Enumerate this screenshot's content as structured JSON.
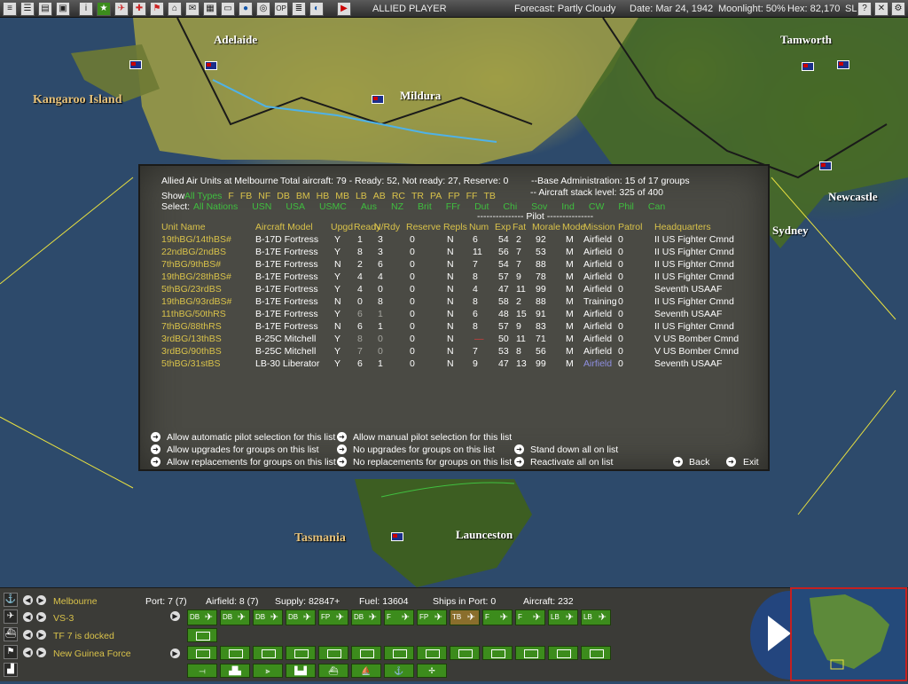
{
  "topbar": {
    "side": "ALLIED PLAYER",
    "forecast": "Forecast: Partly Cloudy",
    "date": "Date: Mar 24, 1942",
    "moonlight": "Moonlight: 50%",
    "hex": "Hex: 82,170",
    "sl": "SL:",
    "icons": [
      "menu-icon",
      "list-icon",
      "file-icon",
      "computer-icon",
      "info-icon",
      "star-icon",
      "plane-icon",
      "ship-icon",
      "flag-icon",
      "chart-icon",
      "map-icon",
      "base-icon",
      "globe-icon",
      "target-icon",
      "op-icon",
      "report-icon",
      "moon-icon",
      "play-icon"
    ]
  },
  "map_labels": {
    "adelaide": "Adelaide",
    "kangaroo": "Kangaroo Island",
    "mildura": "Mildura",
    "tamworth": "Tamworth",
    "newcastle": "Newcastle",
    "sydney": "Sydney",
    "tasmania": "Tasmania",
    "launceston": "Launceston"
  },
  "dialog": {
    "header": "Allied Air Units at Melbourne",
    "total": "Total aircraft: 79 - Ready: 52, Not ready: 27, Reserve: 0",
    "base_admin": "--Base Administration: 15 of 17 groups",
    "stack": "-- Aircraft stack level: 325 of 400",
    "show_label": "Show",
    "show_types": [
      "All Types",
      "F",
      "FB",
      "NF",
      "DB",
      "BM",
      "HB",
      "MB",
      "LB",
      "AB",
      "RC",
      "TR",
      "PA",
      "FP",
      "FF",
      "TB"
    ],
    "select_label": "Select:",
    "select_nations": [
      "All Nations",
      "USN",
      "USA",
      "USMC",
      "Aus",
      "NZ",
      "Brit",
      "FFr",
      "Dut",
      "Chi",
      "Sov",
      "Ind",
      "CW",
      "Phil",
      "Can"
    ],
    "pilot_group": "--------------- Pilot ---------------",
    "columns": [
      "Unit Name",
      "Aircraft Model",
      "Upgd",
      "Ready",
      "N/Rdy",
      "Reserve",
      "Repls",
      "Num",
      "Exp",
      "Fat",
      "Morale",
      "Mode",
      "Mission",
      "Patrol",
      "Headquarters"
    ],
    "rows": [
      [
        "19thBG/14thBS#",
        "B-17D Fortress",
        "Y",
        "1",
        "3",
        "0",
        "N",
        "6",
        "54",
        "2",
        "92",
        "M",
        "Airfield",
        "0",
        "II US Fighter Cmnd"
      ],
      [
        "22ndBG/2ndBS",
        "B-17E Fortress",
        "Y",
        "8",
        "3",
        "0",
        "N",
        "11",
        "56",
        "7",
        "53",
        "M",
        "Airfield",
        "0",
        "II US Fighter Cmnd"
      ],
      [
        "7thBG/9thBS#",
        "B-17E Fortress",
        "N",
        "2",
        "6",
        "0",
        "N",
        "7",
        "54",
        "7",
        "88",
        "M",
        "Airfield",
        "0",
        "II US Fighter Cmnd"
      ],
      [
        "19thBG/28thBS#",
        "B-17E Fortress",
        "Y",
        "4",
        "4",
        "0",
        "N",
        "8",
        "57",
        "9",
        "78",
        "M",
        "Airfield",
        "0",
        "II US Fighter Cmnd"
      ],
      [
        "5thBG/23rdBS",
        "B-17E Fortress",
        "Y",
        "4",
        "0",
        "0",
        "N",
        "4",
        "47",
        "11",
        "99",
        "M",
        "Airfield",
        "0",
        "Seventh USAAF"
      ],
      [
        "19thBG/93rdBS#",
        "B-17E Fortress",
        "N",
        "0",
        "8",
        "0",
        "N",
        "8",
        "58",
        "2",
        "88",
        "M",
        "Training",
        "0",
        "II US Fighter Cmnd"
      ],
      [
        "11thBG/50thRS",
        "B-17E Fortress",
        "Y",
        "6",
        "1",
        "0",
        "N",
        "6",
        "48",
        "15",
        "91",
        "M",
        "Airfield",
        "0",
        "Seventh USAAF"
      ],
      [
        "7thBG/88thRS",
        "B-17E Fortress",
        "N",
        "6",
        "1",
        "0",
        "N",
        "8",
        "57",
        "9",
        "83",
        "M",
        "Airfield",
        "0",
        "II US Fighter Cmnd"
      ],
      [
        "3rdBG/13thBS",
        "B-25C Mitchell",
        "Y",
        "8",
        "0",
        "0",
        "N",
        "",
        "50",
        "11",
        "71",
        "M",
        "Airfield",
        "0",
        "V US Bomber Cmnd"
      ],
      [
        "3rdBG/90thBS",
        "B-25C Mitchell",
        "Y",
        "7",
        "0",
        "0",
        "N",
        "7",
        "53",
        "8",
        "56",
        "M",
        "Airfield",
        "0",
        "V US Bomber Cmnd"
      ],
      [
        "5thBG/31stBS",
        "LB-30 Liberator",
        "Y",
        "6",
        "1",
        "0",
        "N",
        "9",
        "47",
        "13",
        "99",
        "M",
        "Airfield",
        "0",
        "Seventh USAAF"
      ]
    ],
    "options": {
      "auto_pilot": "Allow automatic pilot selection for this list",
      "manual_pilot": "Allow manual pilot selection for this list",
      "allow_upg": "Allow upgrades for groups on this list",
      "no_upg": "No upgrades for groups on this list",
      "stand_down": "Stand down all on list",
      "allow_repl": "Allow replacements for groups on this list",
      "no_repl": "No replacements for groups on this list",
      "reactivate": "Reactivate all on list",
      "back": "Back",
      "exit": "Exit"
    }
  },
  "bottom": {
    "base": "Melbourne",
    "port": "Port: 7 (7)",
    "airfield": "Airfield: 8 (7)",
    "supply": "Supply: 82847+",
    "fuel": "Fuel: 13604",
    "ships": "Ships in Port: 0",
    "aircraft": "Aircraft: 232",
    "air_group": "VS-3",
    "tf": "TF 7 is docked",
    "land": "New Guinea Force",
    "plane_labels": [
      "DB",
      "DB",
      "DB",
      "DB",
      "FP",
      "DB",
      "F",
      "FP",
      "TB",
      "F",
      "F",
      "LB",
      "LB"
    ]
  },
  "colors": {
    "dialog_bg": "#4a4a44",
    "unit_text": "#d9c24a",
    "filter_text": "#3fbf3f",
    "counter_green": "#3c8c1c"
  }
}
